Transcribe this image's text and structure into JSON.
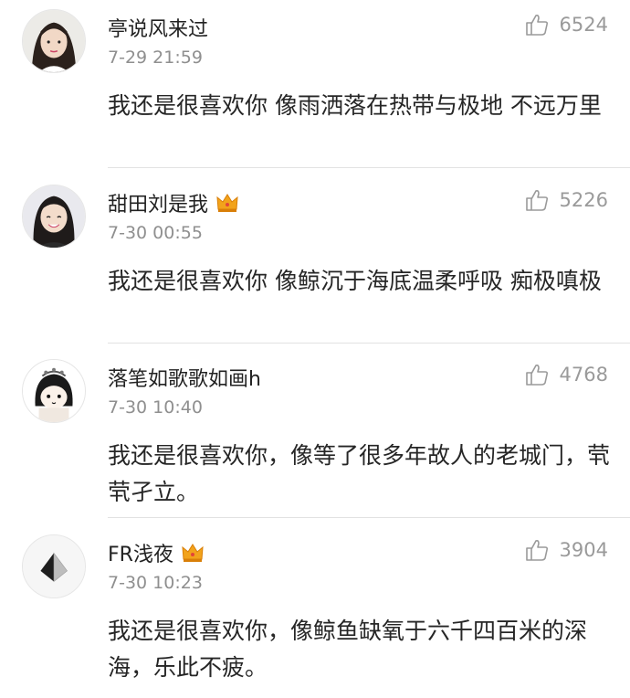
{
  "comments": [
    {
      "user": "亭说风来过",
      "time": "7-29 21:59",
      "likes": "6524",
      "text": "我还是很喜欢你 像雨洒落在热带与极地 不远万里",
      "badge": null
    },
    {
      "user": "甜田刘是我",
      "time": "7-30 00:55",
      "likes": "5226",
      "text": "我还是很喜欢你 像鲸沉于海底温柔呼吸 痴极嗔极",
      "badge": "crown-icon"
    },
    {
      "user": "落笔如歌歌如画h",
      "time": "7-30 10:40",
      "likes": "4768",
      "text": "我还是很喜欢你，像等了很多年故人的老城门，茕茕孑立。",
      "badge": null
    },
    {
      "user": "FR浅夜",
      "time": "7-30 10:23",
      "likes": "3904",
      "text": "我还是很喜欢你，像鲸鱼缺氧于六千四百米的深海，乐此不疲。",
      "badge": "crown-icon"
    }
  ],
  "colors": {
    "name": "#222222",
    "time": "#8f8f8f",
    "likes": "#9a9a9a",
    "divider": "#e2e2e2",
    "crown": "#f2a31b"
  }
}
